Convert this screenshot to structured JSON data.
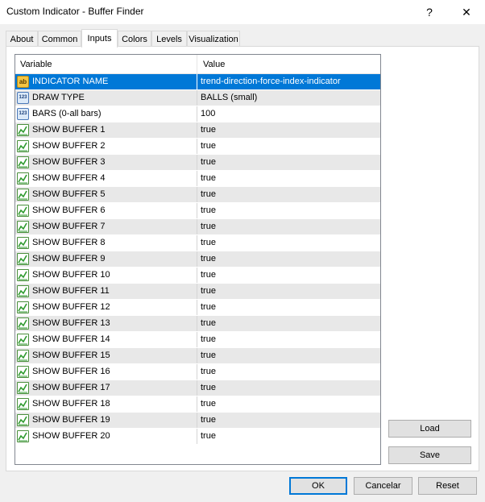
{
  "window": {
    "title": "Custom Indicator - Buffer Finder",
    "help_glyph": "?",
    "close_glyph": "✕"
  },
  "tabs": [
    {
      "label": "About"
    },
    {
      "label": "Common"
    },
    {
      "label": "Inputs",
      "active": true
    },
    {
      "label": "Colors"
    },
    {
      "label": "Levels"
    },
    {
      "label": "Visualization"
    }
  ],
  "grid": {
    "col_variable": "Variable",
    "col_value": "Value",
    "rows": [
      {
        "icon": "string-ab-icon",
        "name": "INDICATOR NAME",
        "value": "trend-direction-force-index-indicator",
        "selected": true
      },
      {
        "icon": "integer-123-icon",
        "name": "DRAW TYPE",
        "value": "BALLS (small)"
      },
      {
        "icon": "integer-123-icon",
        "name": "BARS (0-all bars)",
        "value": "100"
      },
      {
        "icon": "bool-chart-icon",
        "name": "SHOW BUFFER 1",
        "value": "true"
      },
      {
        "icon": "bool-chart-icon",
        "name": "SHOW BUFFER 2",
        "value": "true"
      },
      {
        "icon": "bool-chart-icon",
        "name": "SHOW BUFFER 3",
        "value": "true"
      },
      {
        "icon": "bool-chart-icon",
        "name": "SHOW BUFFER 4",
        "value": "true"
      },
      {
        "icon": "bool-chart-icon",
        "name": "SHOW BUFFER 5",
        "value": "true"
      },
      {
        "icon": "bool-chart-icon",
        "name": "SHOW BUFFER 6",
        "value": "true"
      },
      {
        "icon": "bool-chart-icon",
        "name": "SHOW BUFFER 7",
        "value": "true"
      },
      {
        "icon": "bool-chart-icon",
        "name": "SHOW BUFFER 8",
        "value": "true"
      },
      {
        "icon": "bool-chart-icon",
        "name": "SHOW BUFFER 9",
        "value": "true"
      },
      {
        "icon": "bool-chart-icon",
        "name": "SHOW BUFFER 10",
        "value": "true"
      },
      {
        "icon": "bool-chart-icon",
        "name": "SHOW BUFFER 11",
        "value": "true"
      },
      {
        "icon": "bool-chart-icon",
        "name": "SHOW BUFFER 12",
        "value": "true"
      },
      {
        "icon": "bool-chart-icon",
        "name": "SHOW BUFFER 13",
        "value": "true"
      },
      {
        "icon": "bool-chart-icon",
        "name": "SHOW BUFFER 14",
        "value": "true"
      },
      {
        "icon": "bool-chart-icon",
        "name": "SHOW BUFFER 15",
        "value": "true"
      },
      {
        "icon": "bool-chart-icon",
        "name": "SHOW BUFFER 16",
        "value": "true"
      },
      {
        "icon": "bool-chart-icon",
        "name": "SHOW BUFFER 17",
        "value": "true"
      },
      {
        "icon": "bool-chart-icon",
        "name": "SHOW BUFFER 18",
        "value": "true"
      },
      {
        "icon": "bool-chart-icon",
        "name": "SHOW BUFFER 19",
        "value": "true"
      },
      {
        "icon": "bool-chart-icon",
        "name": "SHOW BUFFER 20",
        "value": "true"
      }
    ]
  },
  "side_buttons": {
    "load": "Load",
    "save": "Save"
  },
  "footer_buttons": {
    "ok": "OK",
    "cancel": "Cancelar",
    "reset": "Reset"
  },
  "colors": {
    "selection": "#0078d7",
    "row_alt": "#e8e8e8"
  }
}
